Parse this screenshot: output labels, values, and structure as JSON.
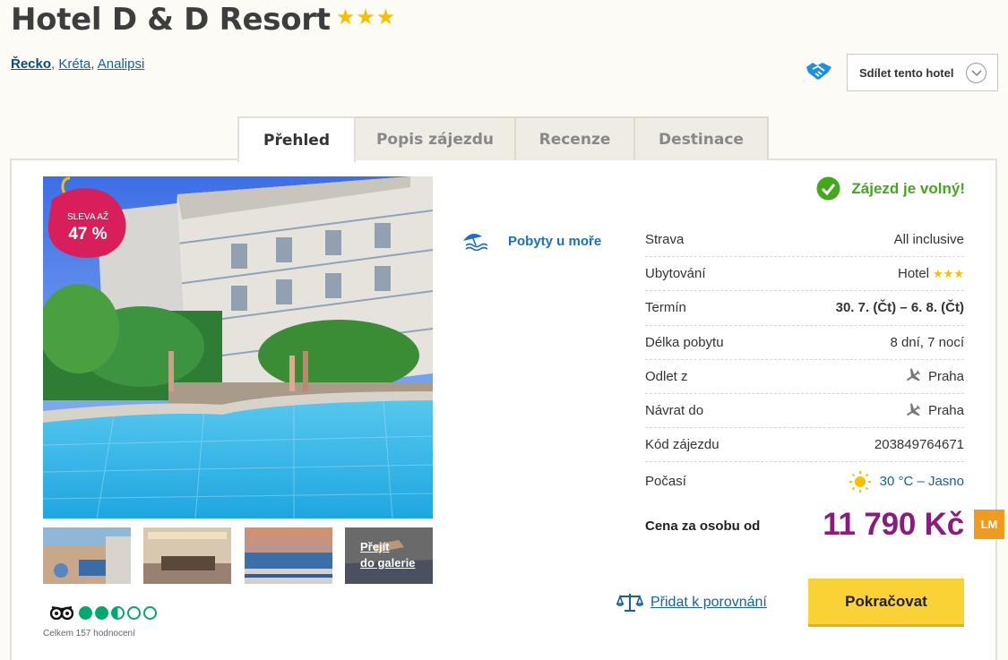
{
  "hotel": {
    "name": "Hotel D & D Resort",
    "stars": "★★★"
  },
  "breadcrumb": [
    "Řecko",
    "Kréta",
    "Analipsi"
  ],
  "share": {
    "label": "Sdílet tento hotel",
    "icon": "handshake-icon"
  },
  "tabs": [
    {
      "label": "Přehled",
      "active": true
    },
    {
      "label": "Popis zájezdu",
      "active": false
    },
    {
      "label": "Recenze",
      "active": false
    },
    {
      "label": "Destinace",
      "active": false
    }
  ],
  "badge": {
    "line1": "SLEVA AŽ",
    "line2": "47 %"
  },
  "gallery": {
    "link_line1": "Přejít",
    "link_line2": "do galerie"
  },
  "tripadvisor": {
    "rating_of_5": 2.5,
    "count_text": "Celkem 157 hodnocení"
  },
  "category": {
    "label": "Pobyty u moře",
    "icon": "beach-umbrella-icon"
  },
  "availability": {
    "text": "Zájezd je volný!",
    "icon": "check-circle-icon"
  },
  "details": [
    {
      "label": "Strava",
      "value": "All inclusive"
    },
    {
      "label": "Ubytování",
      "value": "Hotel",
      "stars": "★★★"
    },
    {
      "label": "Termín",
      "value": "30. 7. (Čt) – 6. 8. (Čt)"
    },
    {
      "label": "Délka pobytu",
      "value": "8 dní, 7 nocí"
    },
    {
      "label": "Odlet z",
      "value": "Praha",
      "icon": "plane-icon"
    },
    {
      "label": "Návrat do",
      "value": "Praha",
      "icon": "plane-icon"
    },
    {
      "label": "Kód zájezdu",
      "value": "203849764671"
    },
    {
      "label": "Počasí",
      "value": "30 °C – Jasno",
      "icon": "sun-icon"
    }
  ],
  "price": {
    "label": "Cena za osobu od",
    "value": "11 790 Kč",
    "tag": "LM"
  },
  "compare": {
    "label": "Přidat k porovnání",
    "icon": "scales-icon"
  },
  "cta": {
    "label": "Pokračovat"
  },
  "colors": {
    "price": "#8b1c7f",
    "cta": "#fad235",
    "available": "#44a81b",
    "link": "#1460aa",
    "tag": "#f09a20"
  }
}
